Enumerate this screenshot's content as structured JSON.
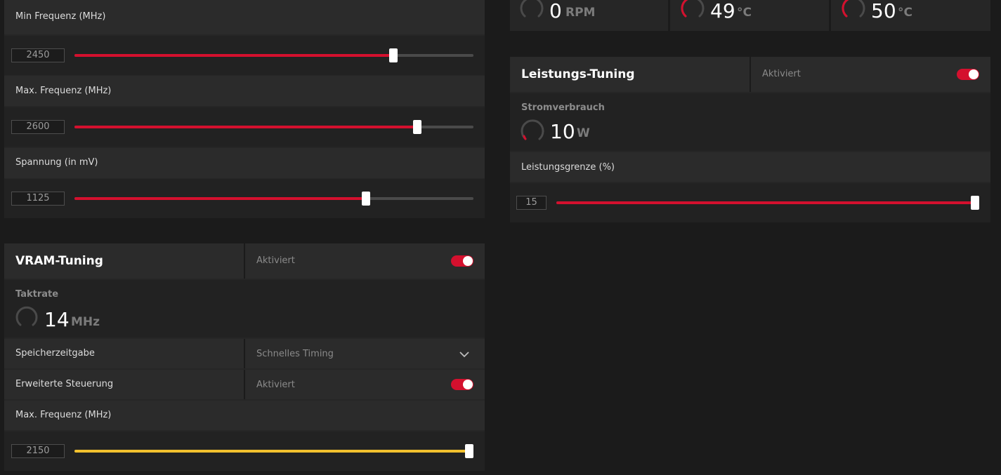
{
  "gpu_tuning": {
    "min_freq": {
      "label": "Min Frequenz (MHz)",
      "value": "2450",
      "fraction": 0.8
    },
    "max_freq": {
      "label": "Max. Frequenz (MHz)",
      "value": "2600",
      "fraction": 0.86
    },
    "voltage": {
      "label": "Spannung (in mV)",
      "value": "1125",
      "fraction": 0.73
    }
  },
  "vram_tuning": {
    "title": "VRAM-Tuning",
    "status": "Aktiviert",
    "enabled": true,
    "clock_label": "Taktrate",
    "clock_value": "14",
    "clock_unit": "MHz",
    "memory_timing": {
      "label": "Speicherzeitgabe",
      "value": "Schnelles Timing"
    },
    "advanced_control": {
      "label": "Erweiterte Steuerung",
      "value": "Aktiviert",
      "enabled": true
    },
    "max_freq": {
      "label": "Max. Frequenz (MHz)",
      "value": "2150",
      "fraction": 1.0
    }
  },
  "metrics": {
    "fan": {
      "value": "0",
      "unit": "RPM"
    },
    "temp1": {
      "value": "49",
      "unit": "°C"
    },
    "temp2": {
      "value": "50",
      "unit": "°C"
    }
  },
  "power_tuning": {
    "title": "Leistungs-Tuning",
    "status": "Aktiviert",
    "enabled": true,
    "consumption_label": "Stromverbrauch",
    "consumption_value": "10",
    "consumption_unit": "W",
    "limit": {
      "label": "Leistungsgrenze (%)",
      "value": "15",
      "fraction": 1.0
    }
  },
  "colors": {
    "accent": "#d4102e",
    "vram_slider": "#f2c12e",
    "background": "#1b1b1b"
  },
  "icons": {
    "dropdown": "chevron-down-icon",
    "gauge": "gauge-arc-icon"
  }
}
